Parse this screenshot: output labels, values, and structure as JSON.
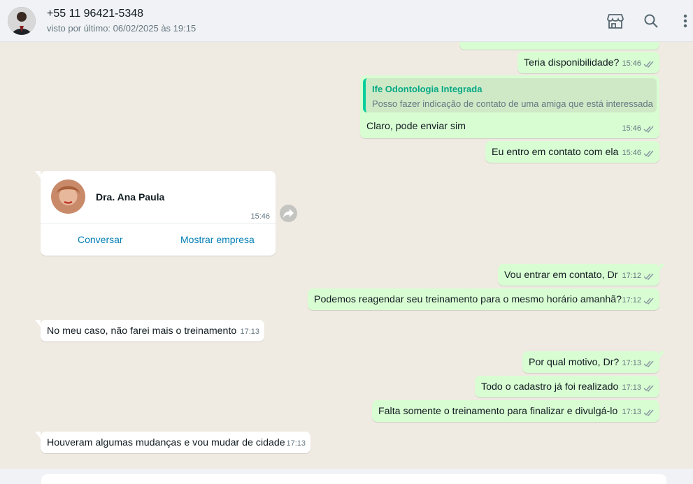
{
  "header": {
    "contact_name": "+55 11 96421-5348",
    "status": "visto por último: 06/02/2025 às 19:15",
    "icons": [
      "store-icon",
      "search-icon",
      "menu-icon"
    ]
  },
  "messages": [
    {
      "dir": "out",
      "text": "Teria disponibilidade?",
      "time": "15:46",
      "status": "read"
    },
    {
      "dir": "out",
      "quote": {
        "author": "Ife Odontologia Integrada",
        "text": "Posso fazer indicação de contato de uma amiga que está interessada"
      },
      "text": "Claro, pode enviar sim",
      "time": "15:46",
      "status": "read"
    },
    {
      "dir": "out",
      "text": "Eu entro em contato com ela",
      "time": "15:46",
      "status": "read"
    },
    {
      "dir": "in",
      "type": "contact-card",
      "contact_name": "Dra. Ana Paula",
      "time": "15:46",
      "actions": [
        "Conversar",
        "Mostrar empresa"
      ]
    },
    {
      "dir": "out",
      "text": "Vou entrar em contato, Dr",
      "time": "17:12",
      "status": "read"
    },
    {
      "dir": "out",
      "text": "Podemos reagendar seu treinamento para o mesmo horário amanhã?",
      "time": "17:12",
      "status": "read"
    },
    {
      "dir": "in",
      "text": "No meu caso, não farei mais o treinamento",
      "time": "17:13"
    },
    {
      "dir": "out",
      "text": "Por qual motivo, Dr?",
      "time": "17:13",
      "status": "read"
    },
    {
      "dir": "out",
      "text": "Todo o cadastro já foi realizado",
      "time": "17:13",
      "status": "read"
    },
    {
      "dir": "out",
      "text": "Falta somente o treinamento para finalizar e divulgá-lo",
      "time": "17:13",
      "status": "read"
    },
    {
      "dir": "in",
      "text": "Houveram algumas mudanças e vou mudar de cidade",
      "time": "17:13"
    }
  ],
  "colors": {
    "outgoing_bubble": "#d9fdd3",
    "incoming_bubble": "#ffffff",
    "chat_background": "#efeae2",
    "read_tick": "#8696a0",
    "quote_accent": "#06cf9c",
    "link": "#027eb5"
  }
}
